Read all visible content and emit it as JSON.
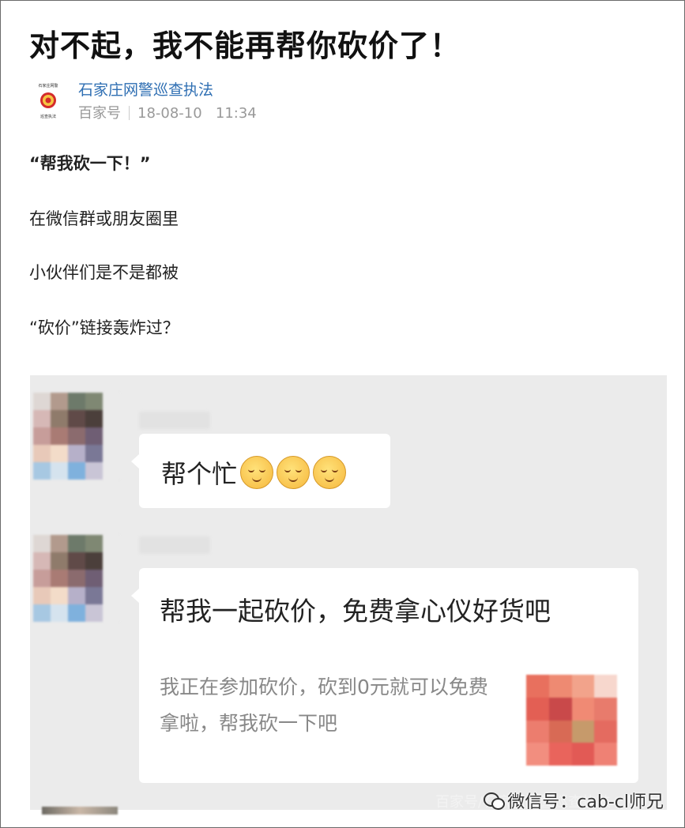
{
  "article": {
    "title": "对不起，我不能再帮你砍价了！",
    "account_name": "石家庄网警巡查执法",
    "platform": "百家号",
    "date": "18-08-10",
    "time": "11:34",
    "logo_text_top": "石家庄网警",
    "logo_text_bottom": "巡查执法"
  },
  "paragraphs": [
    "“帮我砍一下！”",
    "在微信群或朋友圈里",
    "小伙伴们是不是都被",
    "“砍价”链接轰炸过？"
  ],
  "chat": {
    "message1_text": "帮个忙",
    "message1_emoji_icon": "smile-emoji-icon",
    "message2_title": "帮我一起砍价，免费拿心仪好货吧",
    "message2_desc": "我正在参加砍价，砍到0元就可以免费拿啦，帮我砍一下吧"
  },
  "watermark": {
    "label": "微信号：cab-cl师兄",
    "faint": "百家号/石家庄网警巡查执法"
  },
  "colors": {
    "link": "#2f6fb3",
    "chat_bg": "#ebebeb",
    "bubble_bg": "#ffffff"
  }
}
